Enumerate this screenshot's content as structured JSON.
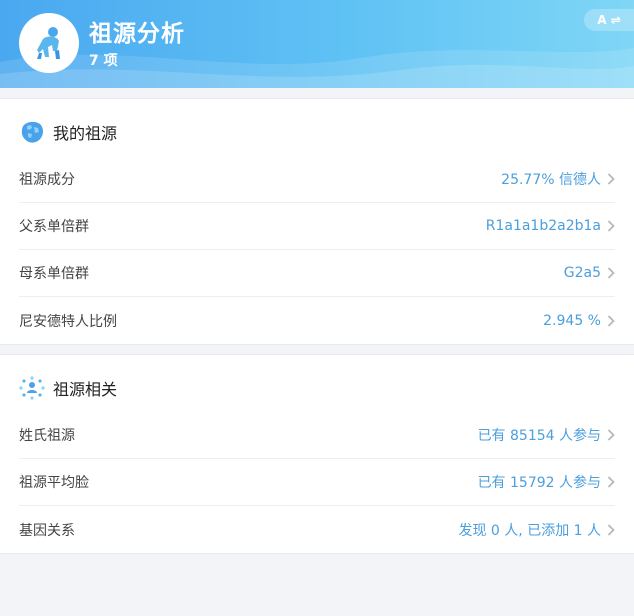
{
  "header": {
    "title": "祖源分析",
    "count": "7 项",
    "lang_toggle": "A ⇌"
  },
  "sections": [
    {
      "title": "我的祖源",
      "icon": "world-map-icon",
      "rows": [
        {
          "label": "祖源成分",
          "value": "25.77% 信德人"
        },
        {
          "label": "父系单倍群",
          "value": "R1a1a1b2a2b1a"
        },
        {
          "label": "母系单倍群",
          "value": "G2a5"
        },
        {
          "label": "尼安德特人比例",
          "value": "2.945 %"
        }
      ]
    },
    {
      "title": "祖源相关",
      "icon": "people-network-icon",
      "rows": [
        {
          "label": "姓氏祖源",
          "value": "已有 85154 人参与"
        },
        {
          "label": "祖源平均脸",
          "value": "已有 15792 人参与"
        },
        {
          "label": "基因关系",
          "value": "发现 0 人, 已添加 1 人"
        }
      ]
    }
  ],
  "colors": {
    "accent": "#4b9fdc",
    "header_start": "#4aa8f0",
    "header_end": "#7fd6f6"
  }
}
